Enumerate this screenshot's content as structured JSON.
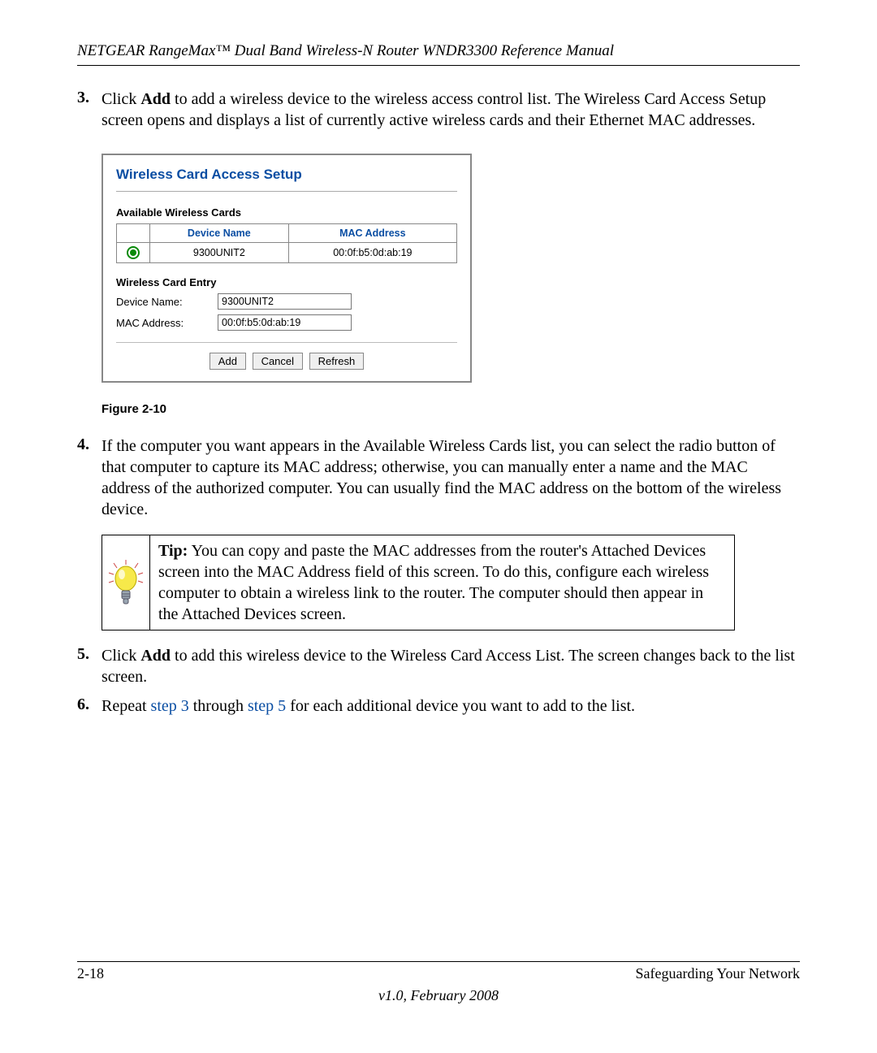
{
  "header": {
    "title": "NETGEAR RangeMax™ Dual Band Wireless-N Router WNDR3300 Reference Manual"
  },
  "steps": {
    "s3": {
      "num": "3.",
      "text_a": "Click ",
      "add": "Add",
      "text_b": " to add a wireless device to the wireless access control list. The Wireless Card Access Setup screen opens and displays a list of currently active wireless cards and their Ethernet MAC addresses."
    },
    "s4": {
      "num": "4.",
      "text": "If the computer you want appears in the Available Wireless Cards list, you can select the radio button of that computer to capture its MAC address; otherwise, you can manually enter a name and the MAC address of the authorized computer. You can usually find the MAC address on the bottom of the wireless device."
    },
    "s5": {
      "num": "5.",
      "text_a": "Click ",
      "add": "Add",
      "text_b": " to add this wireless device to the Wireless Card Access List. The screen changes back to the list screen."
    },
    "s6": {
      "num": "6.",
      "text_a": "Repeat ",
      "link1": "step 3",
      "text_b": " through ",
      "link2": "step 5",
      "text_c": " for each additional device you want to add to the list."
    }
  },
  "panel": {
    "title": "Wireless Card Access Setup",
    "available_label": "Available Wireless Cards",
    "th_device": "Device Name",
    "th_mac": "MAC Address",
    "row1_device": "9300UNIT2",
    "row1_mac": "00:0f:b5:0d:ab:19",
    "entry_label": "Wireless Card Entry",
    "device_label": "Device Name:",
    "mac_label": "MAC Address:",
    "device_value": "9300UNIT2",
    "mac_value": "00:0f:b5:0d:ab:19",
    "btn_add": "Add",
    "btn_cancel": "Cancel",
    "btn_refresh": "Refresh"
  },
  "figure_caption": "Figure 2-10",
  "tip": {
    "label": "Tip:",
    "text": " You can copy and paste the MAC addresses from the router's Attached Devices screen into the MAC Address field of this screen. To do this, configure each wireless computer to obtain a wireless link to the router. The computer should then appear in the Attached Devices screen."
  },
  "footer": {
    "page": "2-18",
    "section": "Safeguarding Your Network",
    "version": "v1.0, February 2008"
  }
}
